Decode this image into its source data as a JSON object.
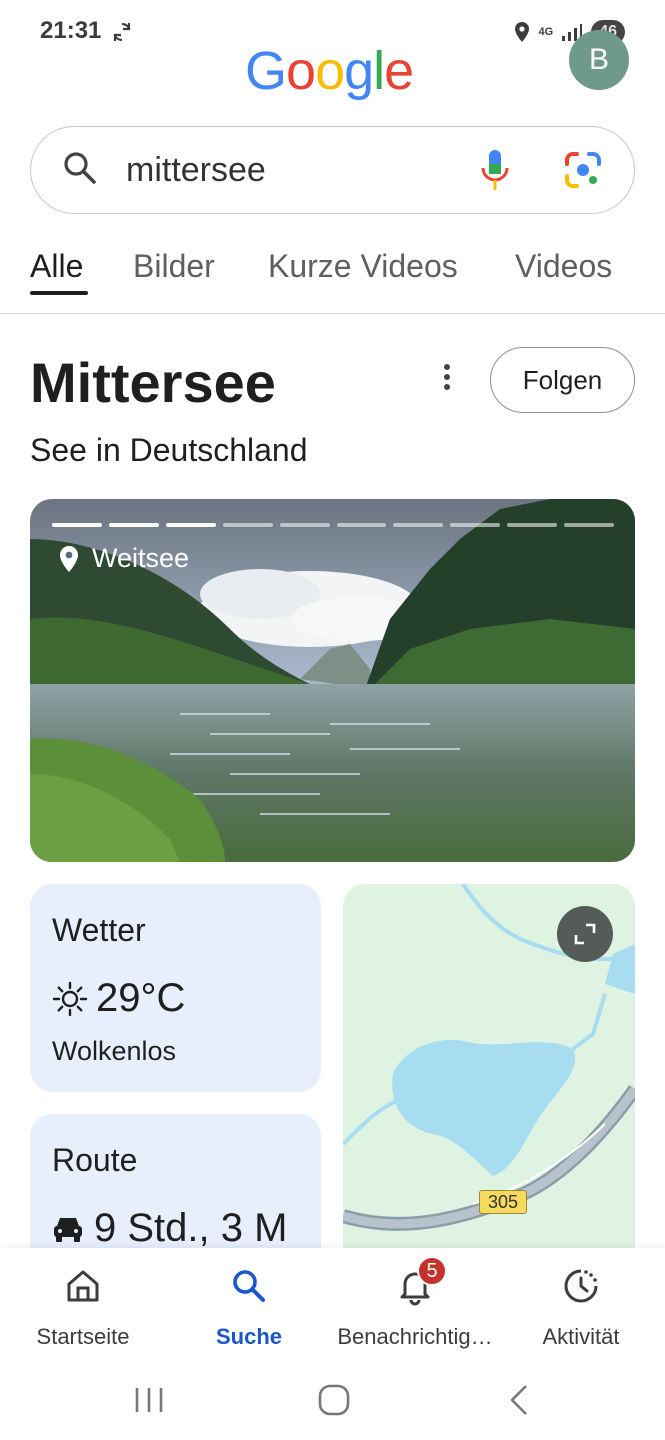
{
  "status_bar": {
    "time": "21:31",
    "network_label": "4G",
    "battery": "46",
    "icons": [
      "sync-icon",
      "location-icon",
      "signal-icon"
    ]
  },
  "header": {
    "logo_text": [
      "G",
      "o",
      "o",
      "g",
      "l",
      "e"
    ],
    "logo_colors": [
      "#4285F4",
      "#EA4335",
      "#FBBC05",
      "#4285F4",
      "#34A853",
      "#EA4335"
    ],
    "avatar_initial": "B"
  },
  "search": {
    "query": "mittersee",
    "icons": [
      "search-icon",
      "mic-icon",
      "lens-icon"
    ]
  },
  "tabs": [
    {
      "label": "Alle",
      "active": true
    },
    {
      "label": "Bilder",
      "active": false
    },
    {
      "label": "Kurze Videos",
      "active": false
    },
    {
      "label": "Videos",
      "active": false
    }
  ],
  "knowledge_panel": {
    "title": "Mittersee",
    "subtitle": "See in Deutschland",
    "follow_label": "Folgen"
  },
  "photo": {
    "location_label": "Weitsee",
    "progress_segments_total": 10,
    "progress_segments_done": 3
  },
  "weather": {
    "title": "Wetter",
    "temperature": "29°C",
    "condition": "Wolkenlos"
  },
  "route": {
    "title": "Route",
    "value": "9 Std., 3 M"
  },
  "map": {
    "road_label": "305"
  },
  "bottom_nav": [
    {
      "label": "Startseite",
      "icon": "home-icon",
      "active": false
    },
    {
      "label": "Suche",
      "icon": "search-icon",
      "active": true
    },
    {
      "label": "Benachrichtig…",
      "icon": "bell-icon",
      "active": false,
      "badge": "5"
    },
    {
      "label": "Aktivität",
      "icon": "activity-icon",
      "active": false
    }
  ],
  "colors": {
    "accent": "#1a57c8",
    "card_bg": "#e7eefc",
    "badge": "#c4322b"
  }
}
